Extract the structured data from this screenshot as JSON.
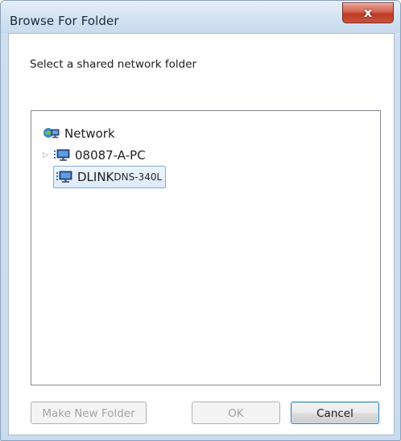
{
  "window": {
    "title": "Browse For Folder",
    "close_label": "x"
  },
  "dialog": {
    "prompt": "Select a shared network folder"
  },
  "tree": {
    "items": [
      {
        "label": "Network",
        "icon": "network-globe-icon",
        "level": 0,
        "expandable": false,
        "selected": false
      },
      {
        "label": "08087-A-PC",
        "icon": "computer-icon",
        "level": 1,
        "expandable": true,
        "selected": false
      },
      {
        "label": "DLINK",
        "sub_label": "DNS-340L",
        "icon": "computer-icon",
        "level": 1,
        "expandable": false,
        "selected": true
      }
    ]
  },
  "buttons": {
    "make_new_folder": "Make New Folder",
    "ok": "OK",
    "cancel": "Cancel"
  },
  "colors": {
    "selection_border": "#84acdd",
    "selection_fill": "#dbeafb",
    "close_button": "#c9523d"
  }
}
